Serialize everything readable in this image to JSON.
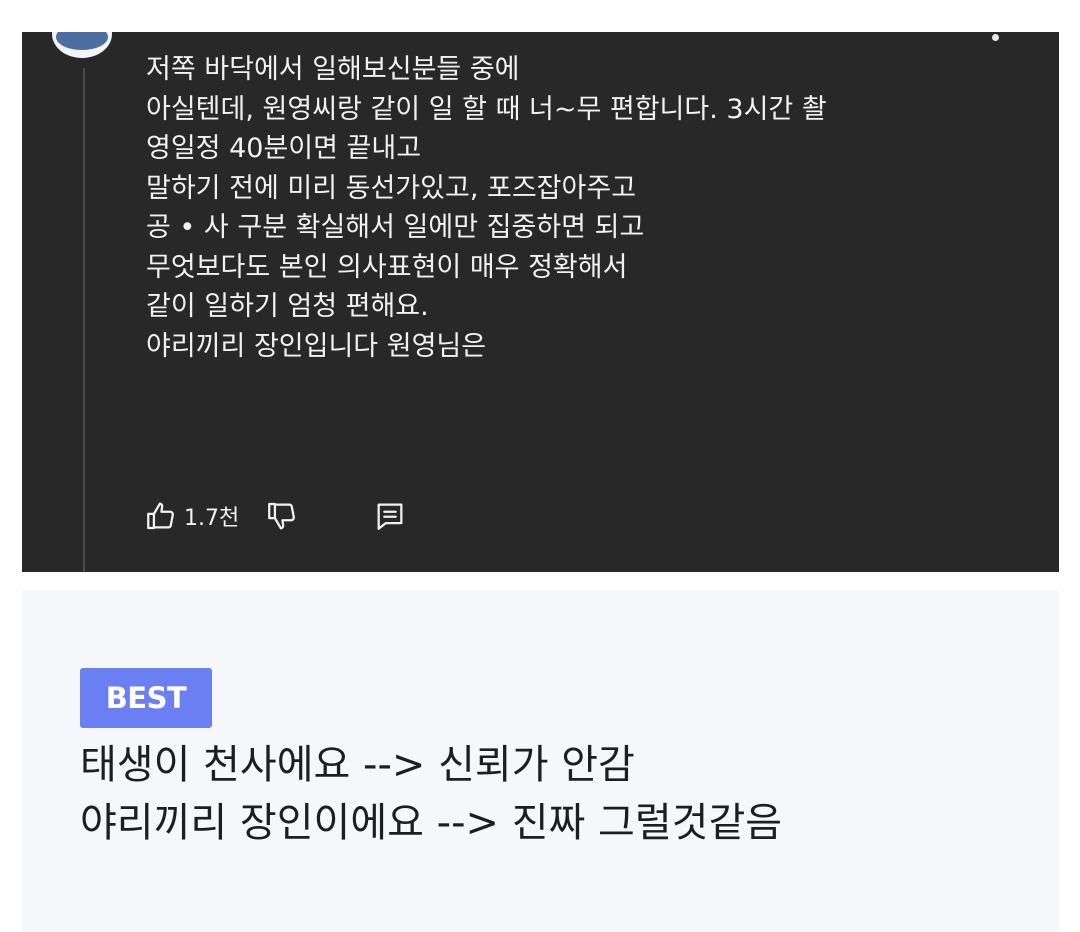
{
  "comment": {
    "lines": [
      "저쪽 바닥에서 일해보신분들 중에",
      "아실텐데, 원영씨랑 같이 일 할 때 너~무 편합니다. 3시간 촬",
      "영일정 40분이면 끝내고",
      "말하기 전에 미리 동선가있고, 포즈잡아주고",
      "공 • 사 구분 확실해서 일에만 집중하면 되고",
      "무엇보다도 본인 의사표현이 매우 정확해서",
      "같이 일하기 엄청 편해요.",
      "야리끼리 장인입니다 원영님은"
    ],
    "like_count": "1.7천",
    "icons": {
      "like": "thumbs-up-icon",
      "dislike": "thumbs-down-icon",
      "reply": "comment-icon",
      "more": "more-dot-icon"
    }
  },
  "best": {
    "badge": "BEST",
    "lines": [
      "태생이 천사에요 --> 신뢰가 안감",
      "야리끼리 장인이에요 --> 진짜 그럴것같음"
    ]
  },
  "colors": {
    "dark_card": "#282828",
    "best_badge": "#6a80f2",
    "best_panel": "#f5f7fb"
  }
}
